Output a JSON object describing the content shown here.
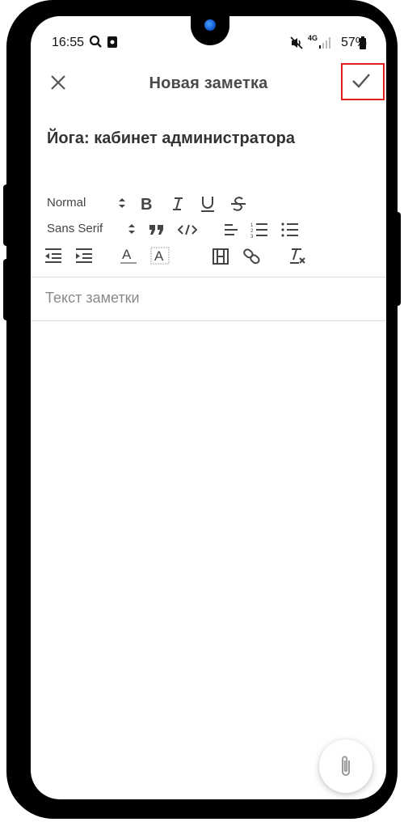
{
  "status_bar": {
    "time": "16:55",
    "battery": "57%",
    "network": "4G"
  },
  "app_bar": {
    "title": "Новая заметка",
    "close_icon": "close-icon",
    "save_icon": "check-icon",
    "highlight_color": "#e02020"
  },
  "note": {
    "title": "Йога: кабинет администратора",
    "body_placeholder": "Текст заметки"
  },
  "toolbar": {
    "heading_select": "Normal",
    "font_select": "Sans Serif",
    "buttons": [
      "bold",
      "italic",
      "underline",
      "strike",
      "blockquote",
      "code-block",
      "align",
      "ordered-list",
      "bullet-list",
      "outdent",
      "indent",
      "text-color",
      "background-color",
      "video",
      "link",
      "clean"
    ]
  },
  "fab": {
    "icon": "paperclip-icon"
  }
}
